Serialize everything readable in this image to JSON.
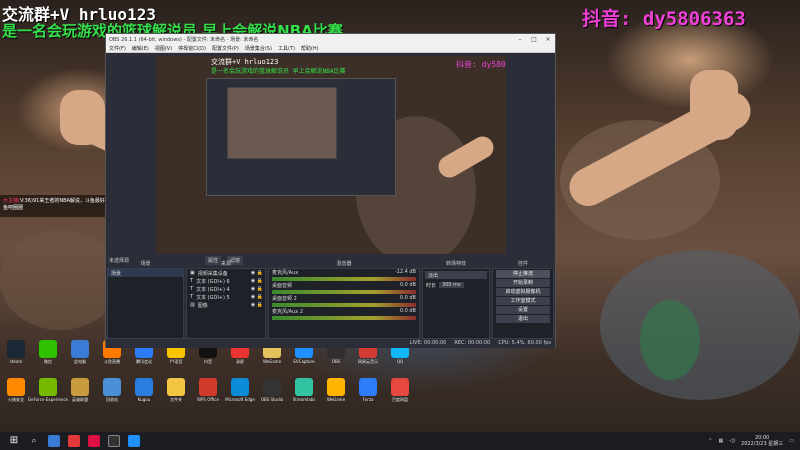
{
  "overlay": {
    "left_line1": "交流群+V hrluo123",
    "left_line2": "是一名会玩游戏的篮球解说员 早上会解说NBA比赛",
    "right_line": "抖音: dy5806363"
  },
  "obs": {
    "title": "OBS 26.1.1 (64-bit, windows) - 配置文件: 未命名 - 场景: 未命名",
    "menu": [
      "文件(F)",
      "编辑(E)",
      "视图(V)",
      "停靠窗口(D)",
      "配置文件(P)",
      "场景集合(S)",
      "工具(T)",
      "帮助(H)"
    ],
    "preview_overlay": {
      "left1": "交流群+V hrluo123",
      "left2": "是一名会玩游戏的篮球解说员 早上会解说NBA比赛",
      "right": "抖音: dy5806363"
    },
    "source_toolbar": [
      "未选择源",
      "属性",
      "滤镜"
    ],
    "docks": {
      "scenes": {
        "title": "场景",
        "items": [
          "场景"
        ]
      },
      "sources": {
        "title": "来源",
        "items": [
          "视频采集设备",
          "文本 (GDI+) 6",
          "文本 (GDI+) 4",
          "文本 (GDI+) 5",
          "图像"
        ]
      },
      "mixer": {
        "title": "混音器",
        "tracks": [
          {
            "name": "麦克风/Aux",
            "db": "-12.4 dB"
          },
          {
            "name": "桌面音频",
            "db": "0.0 dB"
          },
          {
            "name": "桌面音频 2",
            "db": "0.0 dB"
          },
          {
            "name": "麦克风/Aux 2",
            "db": "0.0 dB"
          }
        ]
      },
      "transitions": {
        "title": "转场特效",
        "type": "淡出",
        "duration_label": "时长",
        "duration_value": "300 ms"
      },
      "controls": {
        "title": "控件",
        "buttons": [
          "停止推流",
          "开始录制",
          "启动虚拟摄像机",
          "工作室模式",
          "设置",
          "退出"
        ]
      }
    },
    "status": {
      "live": "LIVE: 00:00:00",
      "rec": "REC: 00:00:00",
      "cpu": "CPU: 5.4%, 60.00 fps"
    }
  },
  "chat": {
    "line1_user": "大主播(",
    "line1_text": "V:36)91来王者的NBA解说，斗鱼最好的篮球解说员，上车观看的请点",
    "line2": "鱼吧圈圈"
  },
  "desktop_icons": [
    {
      "label": "steam",
      "color": "#1b2838"
    },
    {
      "label": "微信",
      "color": "#2dc100"
    },
    {
      "label": "此电脑",
      "color": "#3a7bd5"
    },
    {
      "label": "斗鱼直播",
      "color": "#ff7a00"
    },
    {
      "label": "腾讯会议",
      "color": "#2b7cf6"
    },
    {
      "label": "YY语音",
      "color": "#f6c500"
    },
    {
      "label": "抖音",
      "color": "#111111"
    },
    {
      "label": "录屏",
      "color": "#e33"
    },
    {
      "label": "WeGame",
      "color": "#e4c15a"
    },
    {
      "label": "EVCapture",
      "color": "#1e90ff"
    },
    {
      "label": "OBS",
      "color": "#302e31"
    },
    {
      "label": "网易云音乐",
      "color": "#d43c33"
    },
    {
      "label": "QQ",
      "color": "#12b7f5"
    },
    {
      "label": "火绒安全",
      "color": "#ff8a00"
    },
    {
      "label": "GeForce Experience",
      "color": "#76b900"
    },
    {
      "label": "英雄联盟",
      "color": "#c89b3c"
    },
    {
      "label": "回收站",
      "color": "#4a90d9"
    },
    {
      "label": "Kugou",
      "color": "#2a7de1"
    },
    {
      "label": "文件夹",
      "color": "#f4c542"
    },
    {
      "label": "WPS Office",
      "color": "#d13b2c"
    },
    {
      "label": "Microsoft Edge",
      "color": "#0c8bd8"
    },
    {
      "label": "OBS Studio",
      "color": "#333"
    },
    {
      "label": "Streamlabs",
      "color": "#31c3a2"
    },
    {
      "label": "WeGame",
      "color": "#ffb400"
    },
    {
      "label": "Forza",
      "color": "#2b7cf6"
    },
    {
      "label": "百度网盘",
      "color": "#e6483f"
    }
  ],
  "taskbar": {
    "time": "20:00",
    "date": "2022/3/23 星期三"
  }
}
